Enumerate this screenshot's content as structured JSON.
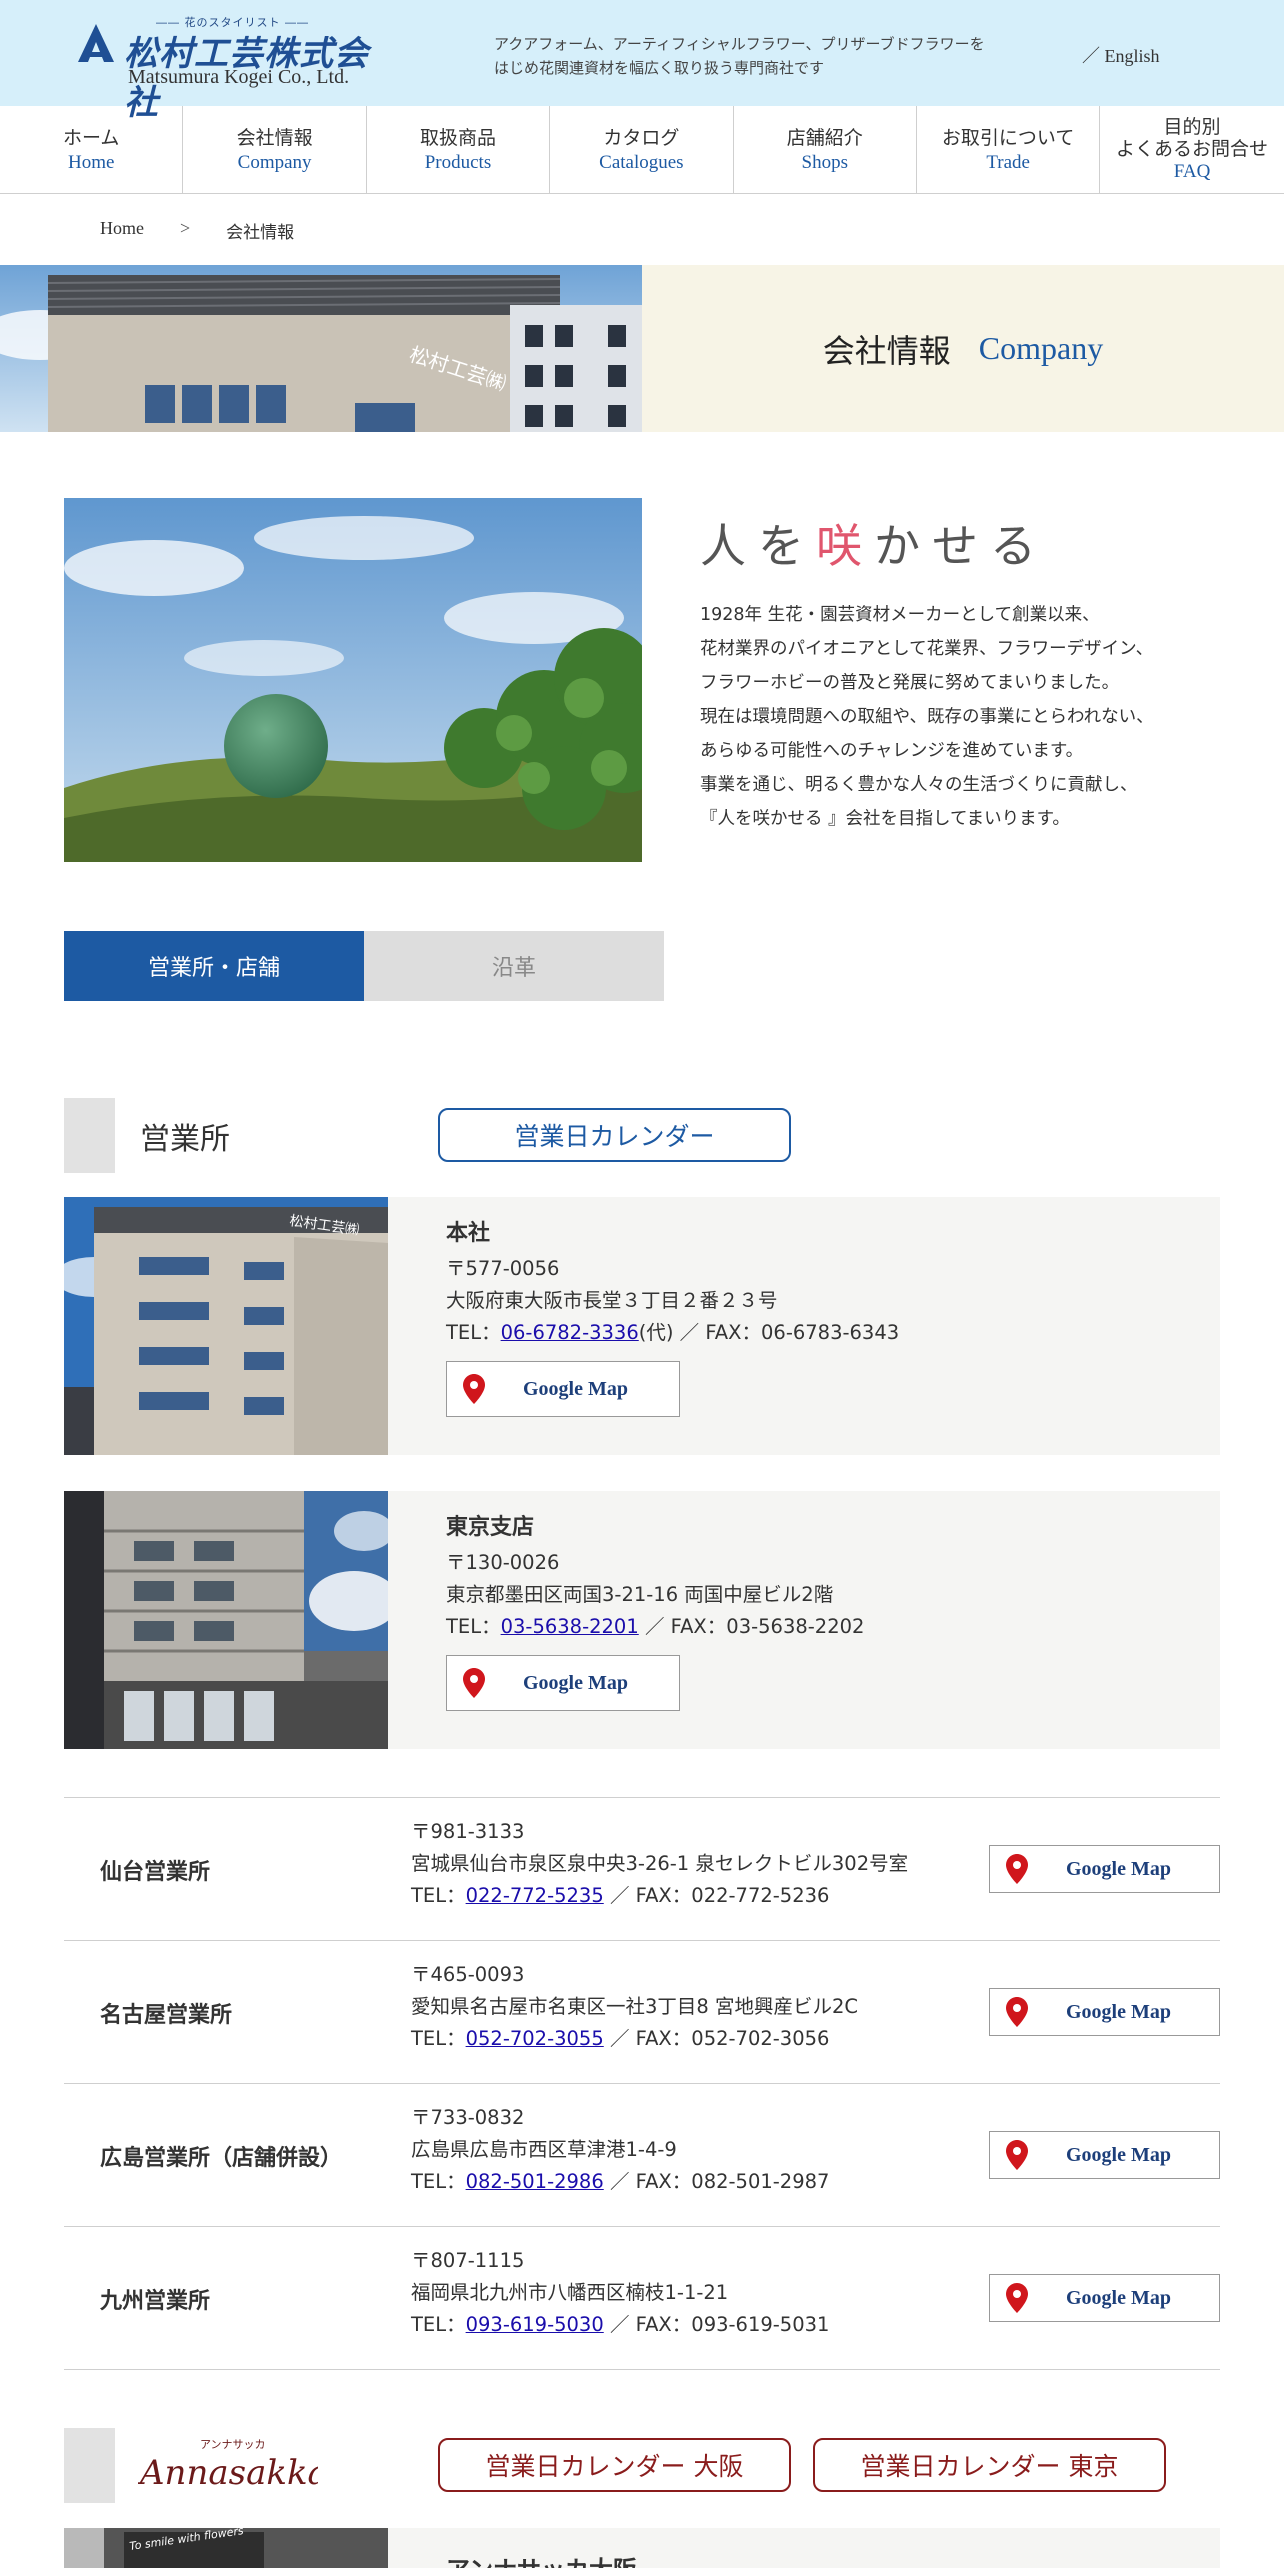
{
  "header": {
    "logo_tag": "―― 花のスタイリスト ――",
    "logo_jp": "松村工芸株式会社",
    "logo_en": "Matsumura Kogei Co., Ltd.",
    "tagline_line1": "アクアフォーム、アーティフィシャルフラワー、プリザーブドフラワーを",
    "tagline_line2": "はじめ花関連資材を幅広く取り扱う専門商社です",
    "lang_link": "／ English"
  },
  "nav": {
    "items": [
      {
        "jp": "ホーム",
        "en": "Home"
      },
      {
        "jp": "会社情報",
        "en": "Company"
      },
      {
        "jp": "取扱商品",
        "en": "Products"
      },
      {
        "jp": "カタログ",
        "en": "Catalogues"
      },
      {
        "jp": "店舗紹介",
        "en": "Shops"
      },
      {
        "jp": "お取引について",
        "en": "Trade"
      },
      {
        "jp": "目的別\nよくあるお問合せ",
        "en": "FAQ"
      }
    ]
  },
  "breadcrumb": {
    "home": "Home",
    "sep": ">",
    "current": "会社情報"
  },
  "page_title": {
    "jp": "会社情報",
    "en": "Company"
  },
  "intro": {
    "heading_before": "人を",
    "heading_highlight": "咲",
    "heading_after": "かせる",
    "para1_lines": [
      "1928年 生花・園芸資材メーカーとして創業以来、",
      "花材業界のパイオニアとして花業界、フラワーデザイン、",
      "フラワーホビーの普及と発展に努めてまいりました。"
    ],
    "para2_lines": [
      "現在は環境問題への取組や、既存の事業にとらわれない、",
      "あらゆる可能性へのチャレンジを進めています。",
      "事業を通じ、明るく豊かな人々の生活づくりに貢献し、",
      "『人を咲かせる 』会社を目指してまいります。"
    ]
  },
  "tabs": {
    "active": "営業所・店舗",
    "inactive": "沿革"
  },
  "offices_section": {
    "title": "営業所",
    "calendar_button": "営業日カレンダー",
    "map_label": "Google Map",
    "tel_label": "TEL：",
    "fax_sep": " ／ FAX：",
    "cards": [
      {
        "name": "本社",
        "postal": "〒577-0056",
        "address": "大阪府東大阪市長堂３丁目２番２３号",
        "tel": "06-6782-3336",
        "tel_suffix": "(代)",
        "fax": "06-6783-6343"
      },
      {
        "name": "東京支店",
        "postal": "〒130-0026",
        "address": "東京都墨田区両国3-21-16 両国中屋ビル2階",
        "tel": "03-5638-2201",
        "tel_suffix": "",
        "fax": "03-5638-2202"
      }
    ],
    "rows": [
      {
        "name": "仙台営業所",
        "postal": "〒981-3133",
        "address": "宮城県仙台市泉区泉中央3-26-1 泉セレクトビル302号室",
        "tel": "022-772-5235",
        "fax": "022-772-5236"
      },
      {
        "name": "名古屋営業所",
        "postal": "〒465-0093",
        "address": "愛知県名古屋市名東区一社3丁目8 宮地興産ビル2C",
        "tel": "052-702-3055",
        "fax": "052-702-3056"
      },
      {
        "name": "広島営業所（店舗併設）",
        "postal": "〒733-0832",
        "address": "広島県広島市西区草津港1-4-9",
        "tel": "082-501-2986",
        "fax": "082-501-2987"
      },
      {
        "name": "九州営業所",
        "postal": "〒807-1115",
        "address": "福岡県北九州市八幡西区楠枝1-1-21",
        "tel": "093-619-5030",
        "fax": "093-619-5031"
      }
    ]
  },
  "anna_section": {
    "logo_ruby": "アンナサッカ",
    "logo_text": "Annasakka",
    "calendar_osaka": "営業日カレンダー 大阪",
    "calendar_tokyo": "営業日カレンダー 東京",
    "shop_name": "アンナサッカ大阪",
    "photo_sign": "To smile with flowers"
  },
  "colors": {
    "header_bg": "#d6effa",
    "brand_blue": "#1d5aa3",
    "accent_pink": "#e0566d",
    "anna_red": "#8a1c1c",
    "card_bg": "#f5f5f3",
    "title_bg": "#f7f4e6",
    "pin_red": "#d0161c"
  },
  "icons": {
    "map_pin": "map-pin-icon"
  }
}
